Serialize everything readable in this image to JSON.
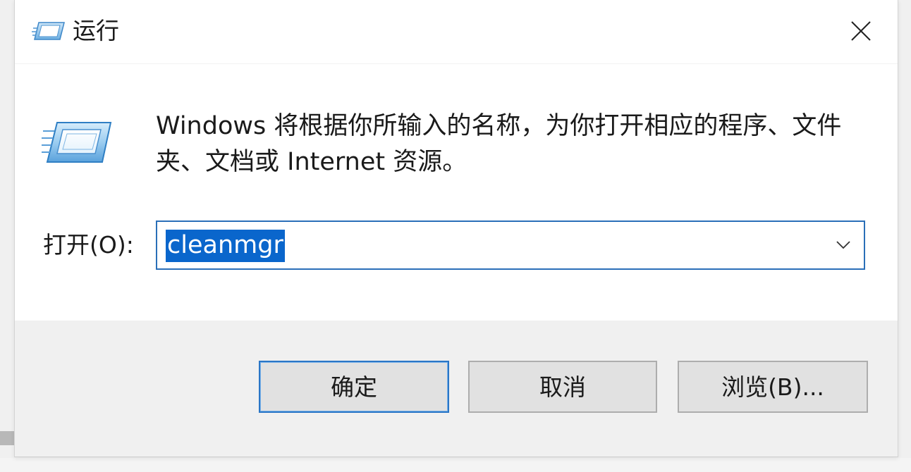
{
  "window": {
    "title": "运行",
    "icon": "run-icon",
    "close_icon": "close-icon"
  },
  "dialog": {
    "description": "Windows 将根据你所输入的名称，为你打开相应的程序、文件夹、文档或 Internet 资源。",
    "open_label": "打开(O):",
    "input_value": "cleanmgr",
    "dropdown_icon": "chevron-down-icon"
  },
  "buttons": {
    "ok": "确定",
    "cancel": "取消",
    "browse": "浏览(B)..."
  },
  "colors": {
    "accent": "#0a66cc",
    "focus_border": "#2a6fb8",
    "footer_bg": "#f0f0f0"
  }
}
